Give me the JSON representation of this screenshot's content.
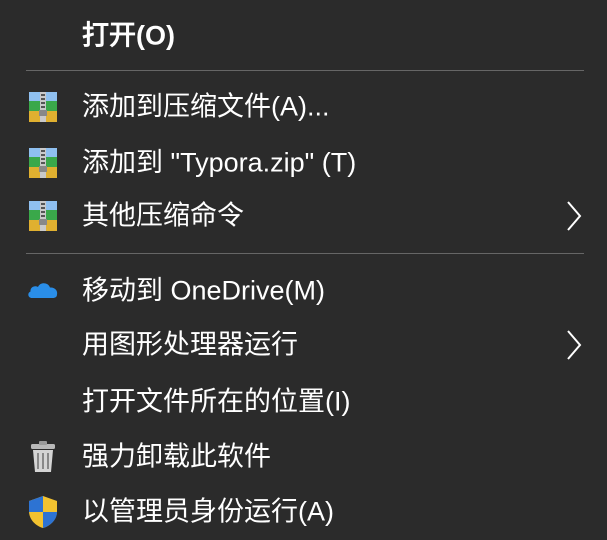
{
  "menu": {
    "items": [
      {
        "label": "打开(O)"
      },
      {
        "label": "添加到压缩文件(A)...",
        "icon": "archive-icon"
      },
      {
        "label": "添加到 \"Typora.zip\" (T)",
        "icon": "archive-icon"
      },
      {
        "label": "其他压缩命令",
        "icon": "archive-icon",
        "submenu": true
      },
      {
        "label": "移动到 OneDrive(M)",
        "icon": "onedrive-cloud-icon"
      },
      {
        "label": "用图形处理器运行",
        "submenu": true
      },
      {
        "label": "打开文件所在的位置(I)"
      },
      {
        "label": "强力卸载此软件",
        "icon": "trash-icon"
      },
      {
        "label": "以管理员身份运行(A)",
        "icon": "uac-shield-icon"
      }
    ]
  },
  "colors": {
    "background": "#2b2b2b",
    "text": "#ffffff",
    "separator": "#666666",
    "onedrive": "#2a8ee8"
  }
}
